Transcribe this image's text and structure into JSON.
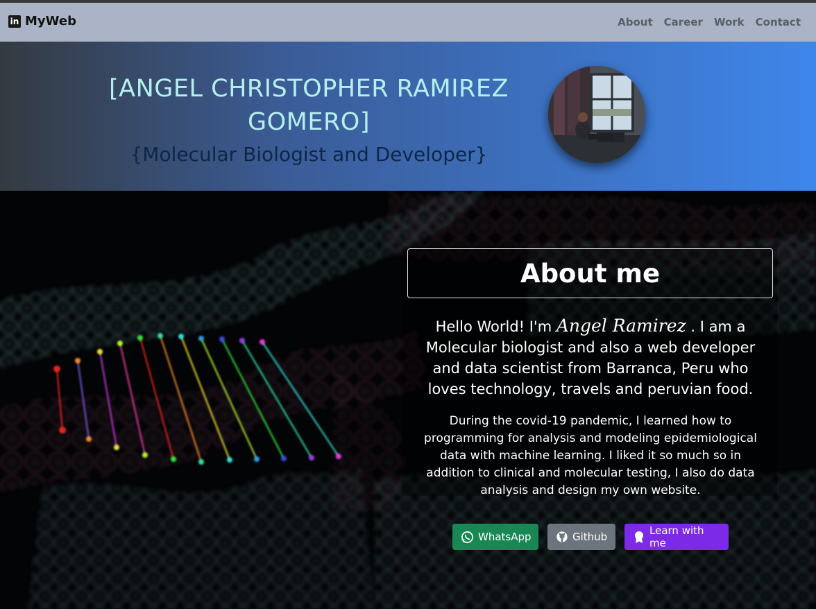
{
  "navbar": {
    "brand_icon_text": "in",
    "brand": "MyWeb",
    "links": [
      "About",
      "Career",
      "Work",
      "Contact"
    ]
  },
  "hero": {
    "name": "[ANGEL CHRISTOPHER RAMIREZ GOMERO]",
    "subtitle": "{Molecular Biologist and Developer}"
  },
  "about": {
    "heading": "About me",
    "intro_before": "Hello World! I'm ",
    "signature": "Angel Ramirez",
    "intro_after": " . I am a Molecular biologist and also a web developer and data scientist from Barranca, Peru who loves technology, travels and peruvian food.",
    "paragraph": "During the covid-19 pandemic, I learned how to programming for analysis and modeling epidemiological data with machine learning. I liked it so much so in addition to clinical and molecular testing, I also do data analysis and design my own website."
  },
  "buttons": {
    "whatsapp": "WhatsApp",
    "github": "Github",
    "learn": "Learn with me"
  },
  "colors": {
    "navbar_bg": "#aab4c6",
    "hero_gradient_start": "#343a40",
    "hero_gradient_end": "#3e86ea",
    "hero_title": "#b5f0ef",
    "hero_subtitle": "#0d2748",
    "whatsapp": "#198754",
    "github": "#6c757d",
    "learn": "#7d2ae8"
  },
  "icons": [
    "linkedin-icon",
    "whatsapp-icon",
    "github-icon",
    "award-icon"
  ]
}
